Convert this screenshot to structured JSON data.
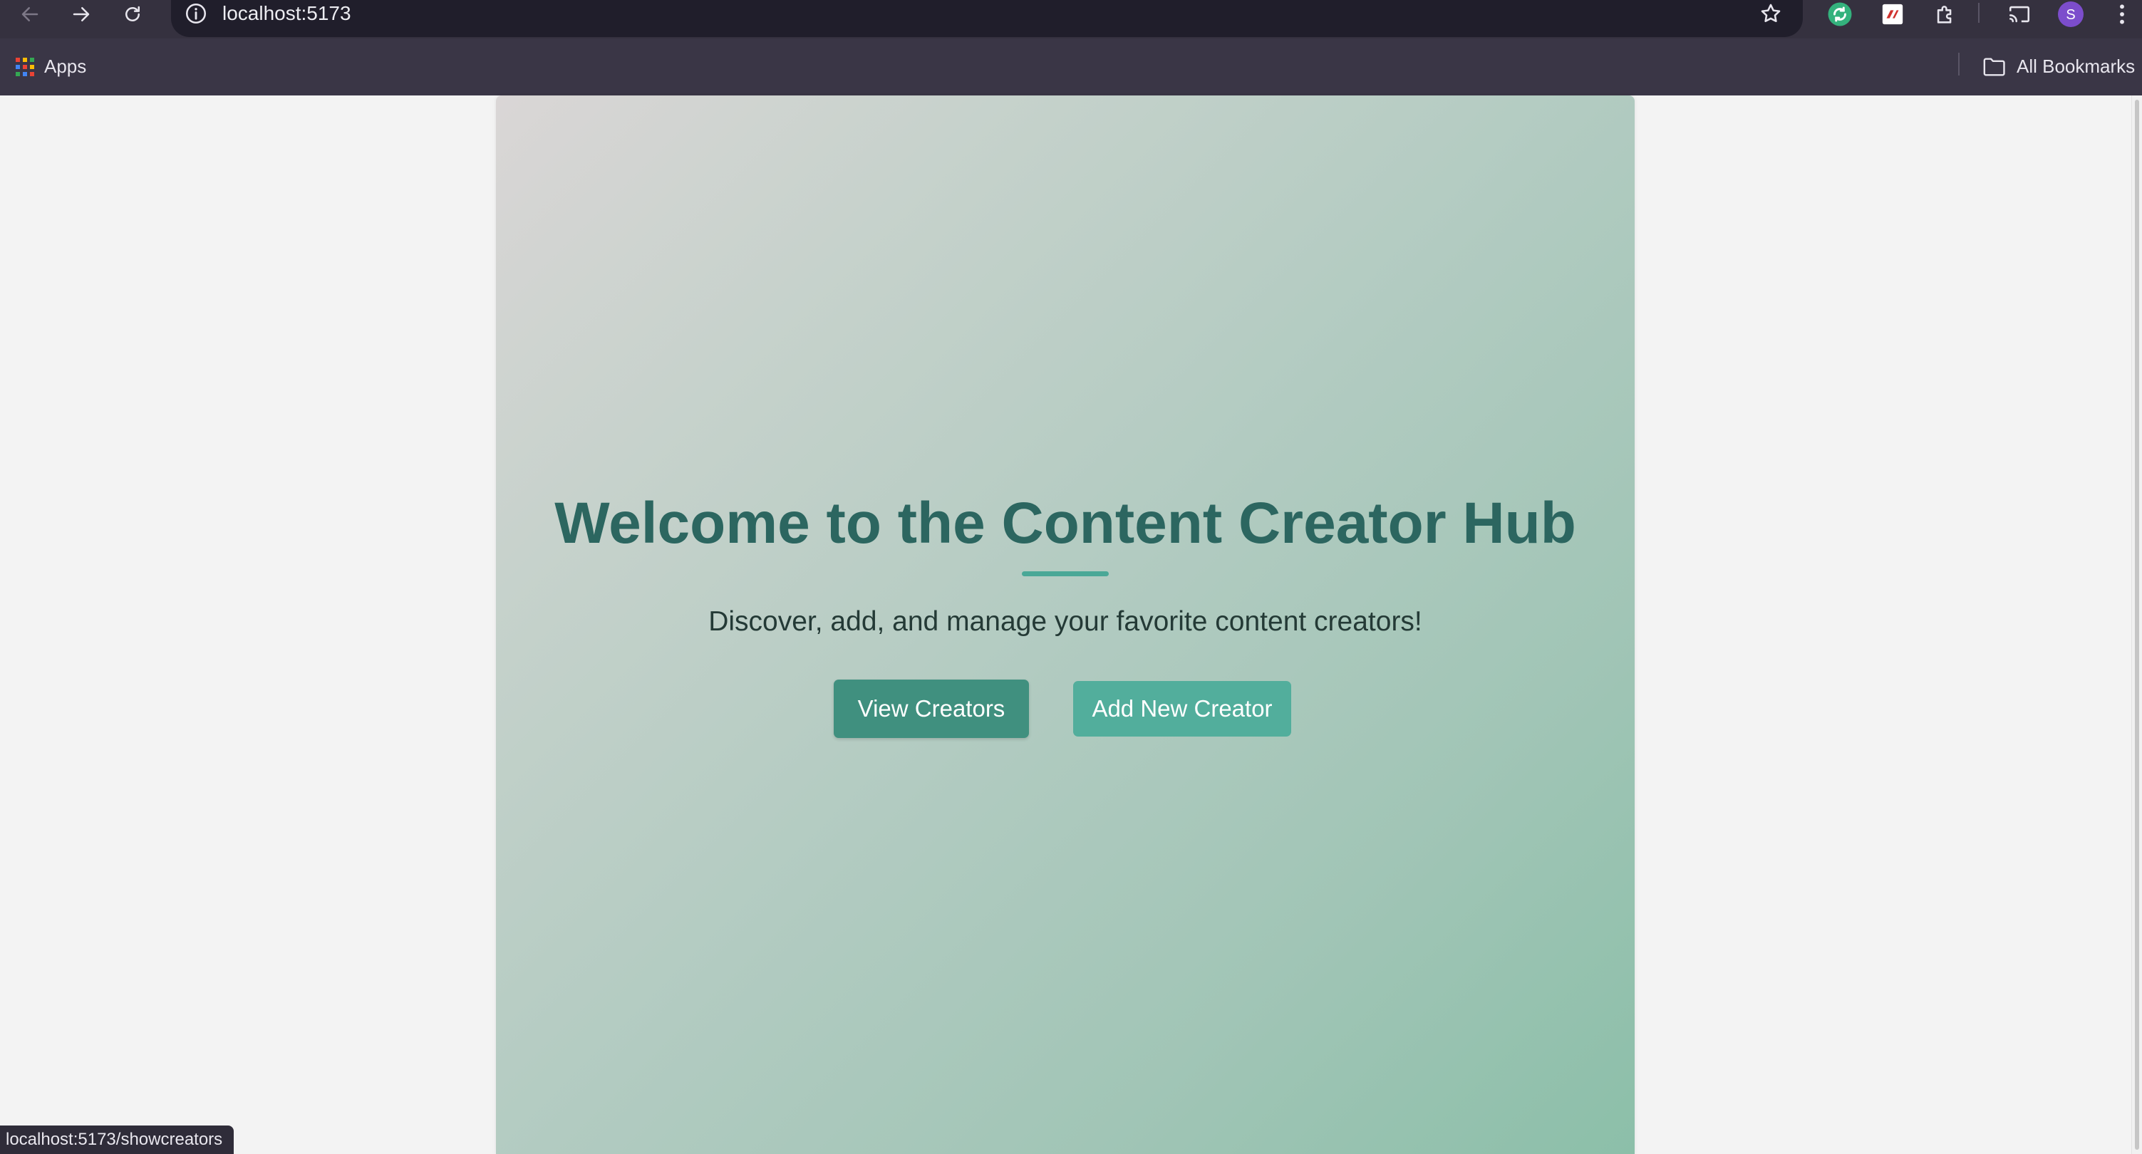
{
  "browser": {
    "url": "localhost:5173",
    "bookmarks": {
      "apps_label": "Apps",
      "all_bookmarks_label": "All Bookmarks"
    },
    "profile_initial": "S",
    "status_url": "localhost:5173/showcreators"
  },
  "hero": {
    "title": "Welcome to the Content Creator Hub",
    "subtitle": "Discover, add, and manage your favorite content creators!",
    "buttons": {
      "view_creators": "View Creators",
      "add_creator": "Add New Creator"
    }
  },
  "colors": {
    "title": "#2c6660",
    "accent": "#4aa897",
    "view_button": "#40907f",
    "add_button": "#52ae9c",
    "browser_toolbar": "#35313f",
    "profile_avatar": "#7c4dcc"
  },
  "icons": [
    "back-icon",
    "forward-icon",
    "reload-icon",
    "info-icon",
    "bookmark-star-icon",
    "extension-sync-icon",
    "extension-pdf-icon",
    "extensions-puzzle-icon",
    "cast-icon",
    "profile-avatar",
    "menu-dots-icon",
    "apps-grid-icon",
    "folder-icon"
  ]
}
